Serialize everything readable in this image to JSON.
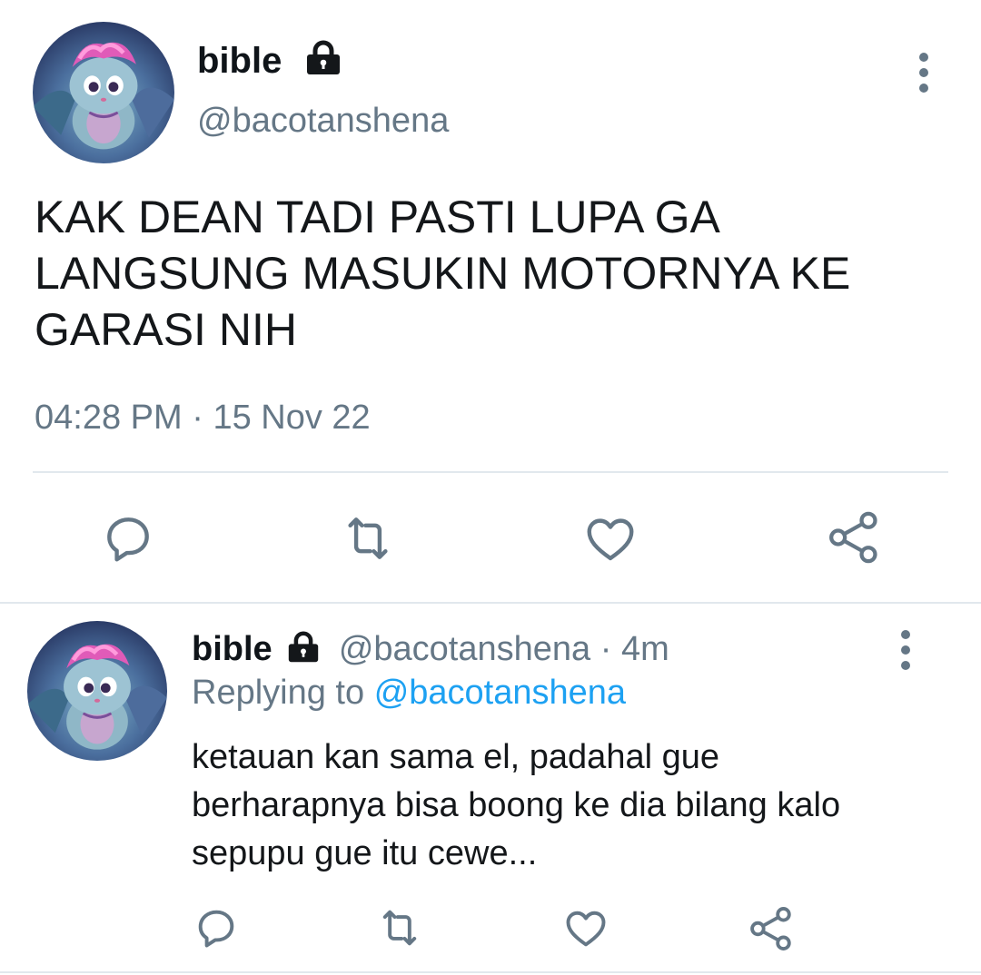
{
  "main_tweet": {
    "author_name": "bible",
    "author_handle": "@bacotanshena",
    "text": "KAK DEAN TADI PASTI LUPA GA LANGSUNG MASUKIN MOTORNYA KE GARASI NIH",
    "time": "04:28 PM",
    "separator": "·",
    "date": "15 Nov 22",
    "avatar_icon": "cartoon-avatar",
    "lock_icon": "lock-icon",
    "actions": [
      "reply-icon",
      "retweet-icon",
      "like-icon",
      "share-icon"
    ]
  },
  "reply_tweet": {
    "author_name": "bible",
    "author_handle": "@bacotanshena",
    "separator": "·",
    "age": "4m",
    "replying_label": "Replying to",
    "replying_handle": "@bacotanshena",
    "text": "ketauan kan sama el, padahal gue berharapnya bisa boong ke dia bilang kalo sepupu gue itu cewe...",
    "actions": [
      "reply-icon",
      "retweet-icon",
      "like-icon",
      "share-icon"
    ]
  },
  "colors": {
    "text_primary": "#0f1419",
    "text_secondary": "#657786",
    "link": "#1da1f2",
    "divider": "#e1e8ed",
    "icon": "#657786"
  }
}
